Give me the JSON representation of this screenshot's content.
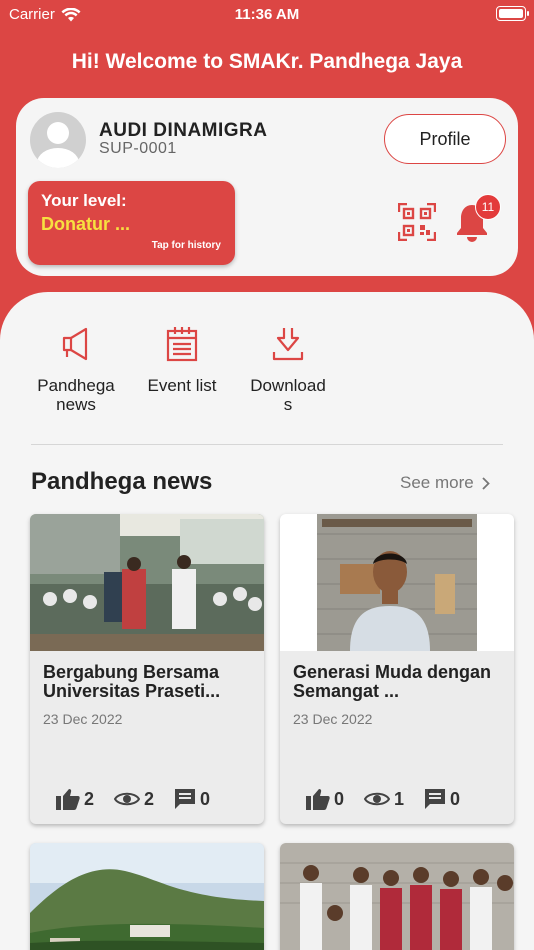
{
  "status_bar": {
    "carrier": "Carrier",
    "time": "11:36 AM"
  },
  "header": {
    "welcome": "Hi! Welcome to SMAKr. Pandhega Jaya"
  },
  "profile_card": {
    "name": "AUDI DINAMIGRA",
    "code": "SUP-0001",
    "profile_button": "Profile",
    "level_label": "Your level:",
    "level_value": "Donatur ...",
    "level_hint": "Tap for history",
    "notification_count": "11",
    "qr_icon": "qr-code-icon",
    "bell_icon": "bell-icon"
  },
  "menu": {
    "items": [
      {
        "label_line1": "Pandhega",
        "label_line2": "news",
        "icon": "megaphone-icon"
      },
      {
        "label_line1": "Event list",
        "label_line2": "",
        "icon": "calendar-icon"
      },
      {
        "label_line1": "Download",
        "label_line2": "s",
        "icon": "download-icon"
      }
    ]
  },
  "news_section": {
    "title": "Pandhega news",
    "see_more": "See more",
    "cards": [
      {
        "title": "Bergabung Bersama Universitas Praseti...",
        "date": "23 Dec 2022",
        "likes": "2",
        "views": "2",
        "comments": "0"
      },
      {
        "title": "Generasi Muda dengan Semangat ...",
        "date": "23 Dec 2022",
        "likes": "0",
        "views": "1",
        "comments": "0"
      }
    ]
  },
  "colors": {
    "primary": "#dc4644",
    "level_value": "#f7e040",
    "badge": "#e33b3b"
  }
}
